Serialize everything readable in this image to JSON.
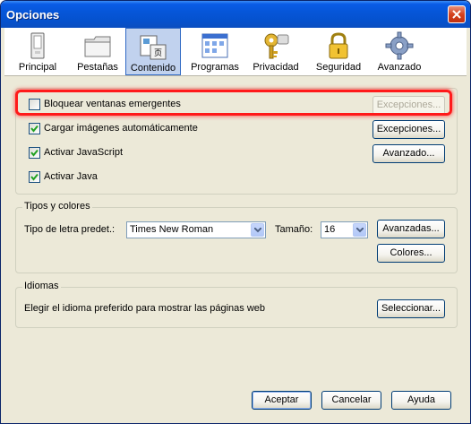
{
  "window": {
    "title": "Opciones",
    "close_icon": "close-icon"
  },
  "toolbar": {
    "items": [
      {
        "label": "Principal",
        "icon": "main-icon"
      },
      {
        "label": "Pestañas",
        "icon": "tabs-folder-icon"
      },
      {
        "label": "Contenido",
        "icon": "content-icon",
        "selected": true
      },
      {
        "label": "Programas",
        "icon": "applications-icon"
      },
      {
        "label": "Privacidad",
        "icon": "privacy-key-icon"
      },
      {
        "label": "Seguridad",
        "icon": "security-lock-icon"
      },
      {
        "label": "Avanzado",
        "icon": "advanced-gear-icon"
      }
    ]
  },
  "content": {
    "block_popups": {
      "label": "Bloquear ventanas emergentes",
      "checked": false,
      "exceptions_button": "Excepciones...",
      "exceptions_enabled": false
    },
    "load_images": {
      "label": "Cargar imágenes automáticamente",
      "checked": true,
      "exceptions_button": "Excepciones..."
    },
    "javascript": {
      "label": "Activar JavaScript",
      "checked": true,
      "advanced_button": "Avanzado..."
    },
    "java": {
      "label": "Activar Java",
      "checked": true
    }
  },
  "fonts": {
    "group_title": "Tipos y colores",
    "default_font_label": "Tipo de letra predet.:",
    "default_font_value": "Times New Roman",
    "size_label": "Tamaño:",
    "size_value": "16",
    "advanced_button": "Avanzadas...",
    "colors_button": "Colores..."
  },
  "languages": {
    "group_title": "Idiomas",
    "description": "Elegir el idioma preferido para mostrar las páginas web",
    "choose_button": "Seleccionar..."
  },
  "footer": {
    "ok": "Aceptar",
    "cancel": "Cancelar",
    "help": "Ayuda"
  },
  "colors": {
    "titlebar": "#0554d2",
    "dialog_bg": "#ece9d8",
    "selected_tab": "#c1d2ee",
    "highlight": "#ff1a1a"
  }
}
